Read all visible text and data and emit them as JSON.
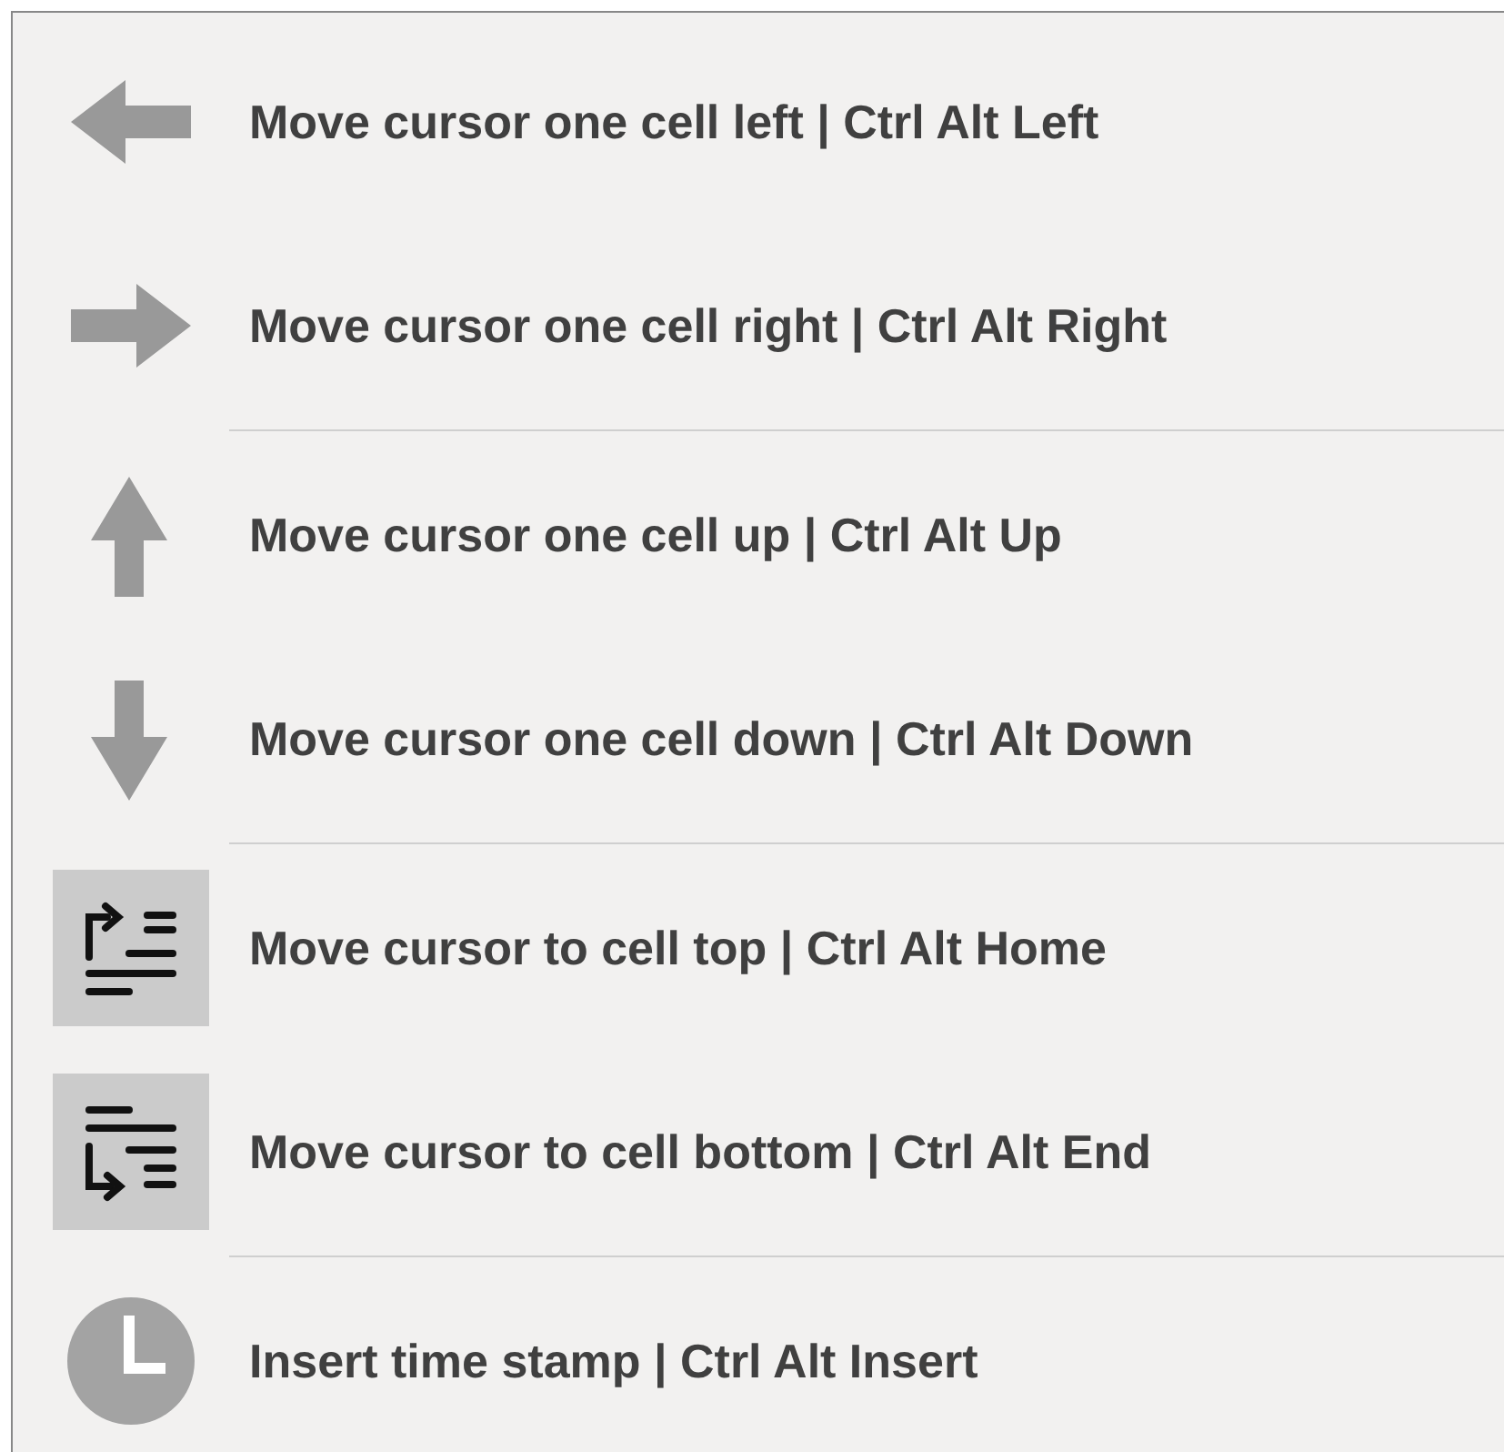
{
  "menu": {
    "groups": [
      {
        "items": [
          {
            "kind": "arrow-left",
            "label": "Move cursor one cell left | Ctrl Alt Left"
          },
          {
            "kind": "arrow-right",
            "label": "Move cursor one cell right | Ctrl Alt Right"
          }
        ]
      },
      {
        "items": [
          {
            "kind": "arrow-up",
            "label": "Move cursor one cell up | Ctrl Alt Up"
          },
          {
            "kind": "arrow-down",
            "label": "Move cursor one cell down | Ctrl Alt Down"
          }
        ]
      },
      {
        "items": [
          {
            "kind": "cell-top",
            "label": "Move cursor to cell top | Ctrl Alt Home"
          },
          {
            "kind": "cell-bottom",
            "label": "Move cursor to cell bottom | Ctrl Alt End"
          }
        ]
      },
      {
        "items": [
          {
            "kind": "clock",
            "label": "Insert time stamp | Ctrl Alt Insert"
          }
        ]
      }
    ]
  }
}
